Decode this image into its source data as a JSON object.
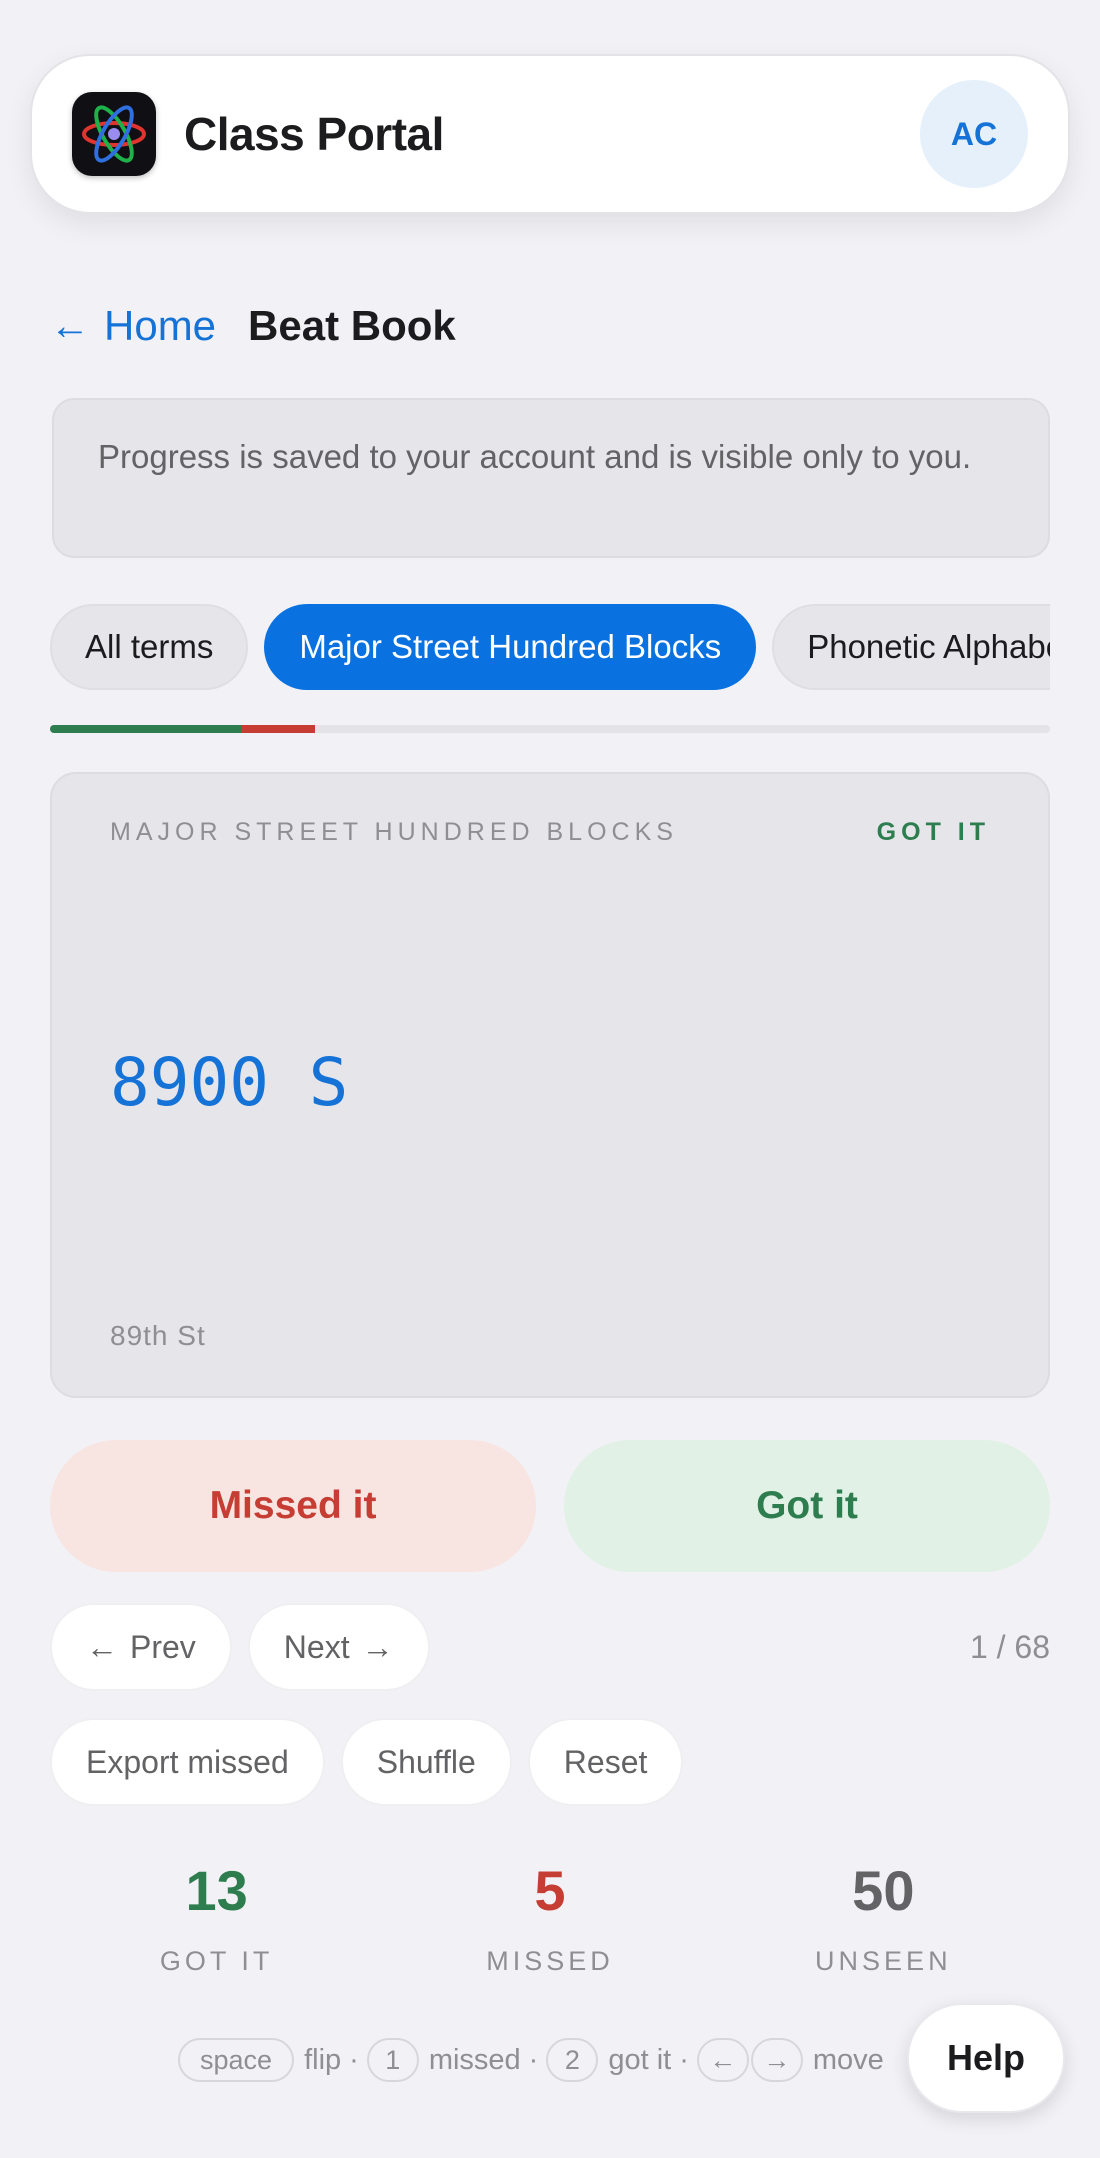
{
  "header": {
    "title": "Class Portal",
    "avatar_initials": "AC",
    "logo_icon": "atom-icon"
  },
  "breadcrumb": {
    "home_label": "Home",
    "current": "Beat Book"
  },
  "notice": "Progress is saved to your account and is visible only to you.",
  "decks": [
    {
      "label": "All terms",
      "active": false
    },
    {
      "label": "Major Street Hundred Blocks",
      "active": true
    },
    {
      "label": "Phonetic Alphabet",
      "active": false
    }
  ],
  "progress": {
    "got": 13,
    "missed": 5,
    "total": 68
  },
  "card": {
    "deck": "MAJOR STREET HUNDRED BLOCKS",
    "status": "GOT IT",
    "term": "8900 S",
    "hint": "89th St"
  },
  "grading": {
    "missed_label": "Missed it",
    "got_label": "Got it"
  },
  "nav": {
    "prev_label": "Prev",
    "next_label": "Next",
    "counter": "1 / 68"
  },
  "actions": {
    "export_label": "Export missed",
    "shuffle_label": "Shuffle",
    "reset_label": "Reset"
  },
  "stats": {
    "got": {
      "value": "13",
      "label": "GOT IT"
    },
    "missed": {
      "value": "5",
      "label": "MISSED"
    },
    "unseen": {
      "value": "50",
      "label": "UNSEEN"
    }
  },
  "shortcuts": {
    "space_key": "space",
    "space_desc": "flip",
    "one_key": "1",
    "one_desc": "missed",
    "two_key": "2",
    "two_desc": "got it",
    "left_key": "←",
    "right_key": "→",
    "arrows_desc": "move"
  },
  "help_label": "Help",
  "colors": {
    "accent": "#0a72e0",
    "success": "#2e7d4f",
    "danger": "#c53d33",
    "muted": "#636366"
  }
}
